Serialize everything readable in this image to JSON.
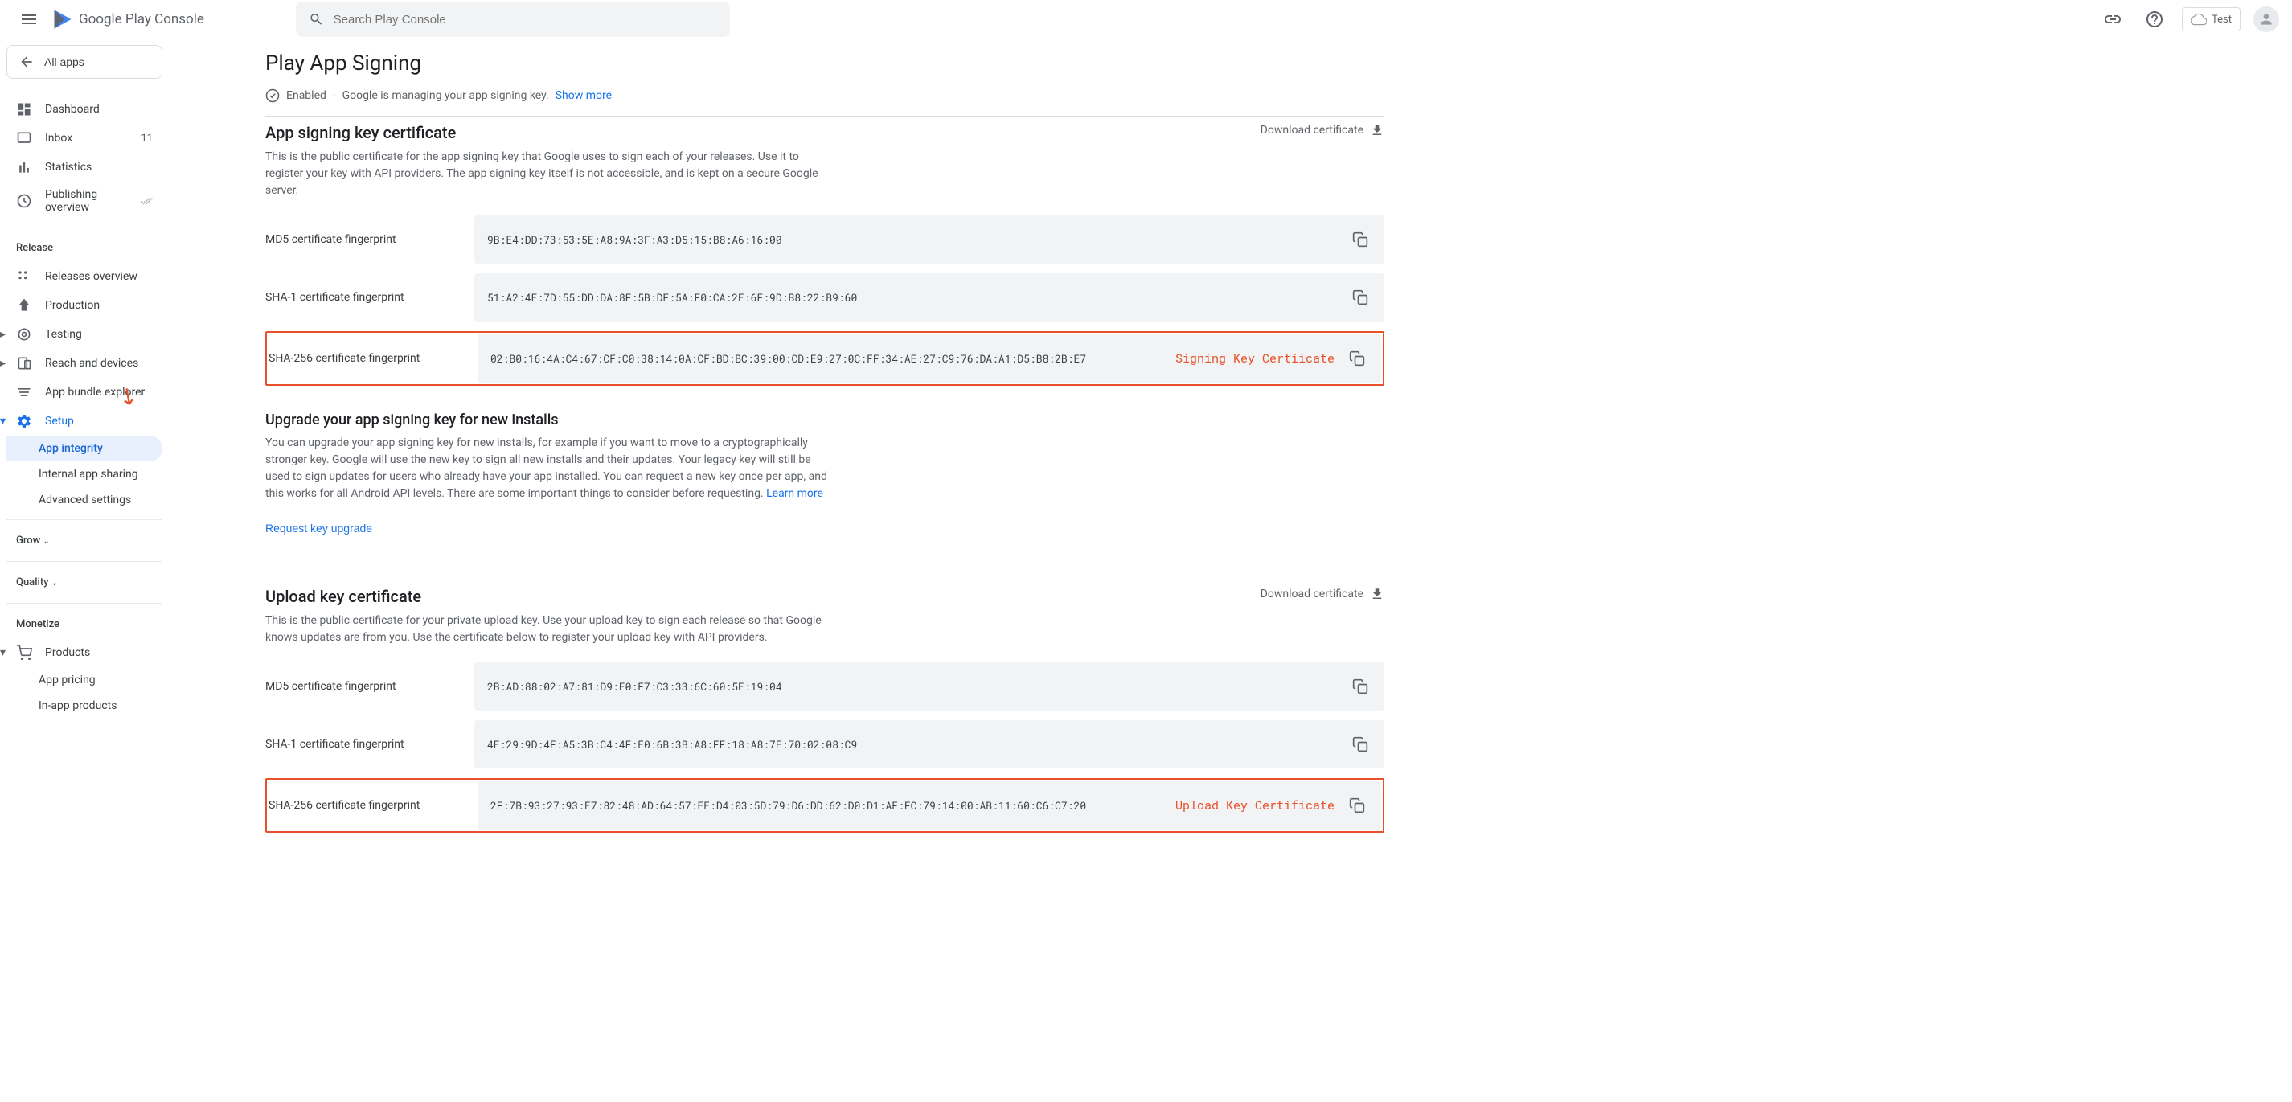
{
  "header": {
    "logo_text": "Google Play Console",
    "search_placeholder": "Search Play Console",
    "test_label": "Test"
  },
  "sidebar": {
    "all_apps": "All apps",
    "dashboard": "Dashboard",
    "inbox": "Inbox",
    "inbox_count": "11",
    "statistics": "Statistics",
    "publishing": "Publishing overview",
    "release_label": "Release",
    "releases_overview": "Releases overview",
    "production": "Production",
    "testing": "Testing",
    "reach": "Reach and devices",
    "bundle_explorer": "App bundle explorer",
    "setup": "Setup",
    "app_integrity": "App integrity",
    "internal_sharing": "Internal app sharing",
    "advanced_settings": "Advanced settings",
    "grow": "Grow",
    "quality": "Quality",
    "monetize": "Monetize",
    "products": "Products",
    "app_pricing": "App pricing",
    "in_app": "In-app products"
  },
  "page": {
    "title": "Play App Signing",
    "enabled": "Enabled",
    "managing": "Google is managing your app signing key.",
    "show_more": "Show more"
  },
  "signing": {
    "title": "App signing key certificate",
    "desc": "This is the public certificate for the app signing key that Google uses to sign each of your releases. Use it to register your key with API providers. The app signing key itself is not accessible, and is kept on a secure Google server.",
    "download": "Download certificate",
    "md5_label": "MD5 certificate fingerprint",
    "md5_value": "9B:E4:DD:73:53:5E:A8:9A:3F:A3:D5:15:B8:A6:16:00",
    "sha1_label": "SHA-1 certificate fingerprint",
    "sha1_value": "51:A2:4E:7D:55:DD:DA:8F:5B:DF:5A:F0:CA:2E:6F:9D:B8:22:B9:60",
    "sha256_label": "SHA-256 certificate fingerprint",
    "sha256_value": "02:B0:16:4A:C4:67:CF:C0:38:14:0A:CF:BD:BC:39:00:CD:E9:27:0C:FF:34:AE:27:C9:76:DA:A1:D5:B8:2B:E7",
    "highlight_label": "Signing Key Certiicate"
  },
  "upgrade": {
    "title": "Upgrade your app signing key for new installs",
    "desc": "You can upgrade your app signing key for new installs, for example if you want to move to a cryptographically stronger key. Google will use the new key to sign all new installs and their updates. Your legacy key will still be used to sign updates for users who already have your app installed. You can request a new key once per app, and this works for all Android API levels. There are some important things to consider before requesting. ",
    "learn_more": "Learn more",
    "request": "Request key upgrade"
  },
  "upload": {
    "title": "Upload key certificate",
    "desc": "This is the public certificate for your private upload key. Use your upload key to sign each release so that Google knows updates are from you. Use the certificate below to register your upload key with API providers.",
    "download": "Download certificate",
    "md5_label": "MD5 certificate fingerprint",
    "md5_value": "2B:AD:88:02:A7:81:D9:E0:F7:C3:33:6C:60:5E:19:04",
    "sha1_label": "SHA-1 certificate fingerprint",
    "sha1_value": "4E:29:9D:4F:A5:3B:C4:4F:E0:6B:3B:A8:FF:18:A8:7E:70:02:08:C9",
    "sha256_label": "SHA-256 certificate fingerprint",
    "sha256_value": "2F:7B:93:27:93:E7:82:48:AD:64:57:EE:D4:03:5D:79:D6:DD:62:D0:D1:AF:FC:79:14:00:AB:11:60:C6:C7:20",
    "highlight_label": "Upload Key Certificate"
  }
}
